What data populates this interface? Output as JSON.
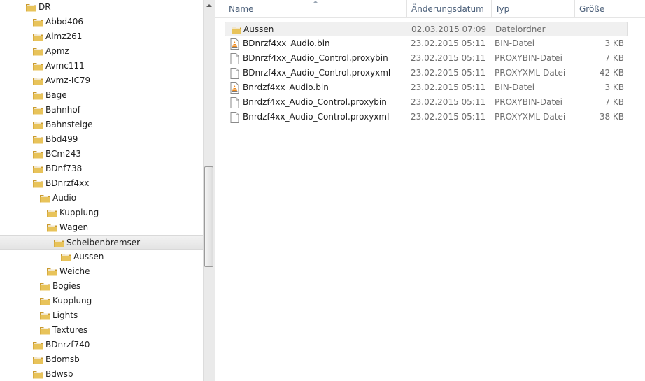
{
  "tree": {
    "items": [
      {
        "label": "DR",
        "depth": 0,
        "selected": false
      },
      {
        "label": "Abbd406",
        "depth": 1,
        "selected": false
      },
      {
        "label": "Aimz261",
        "depth": 1,
        "selected": false
      },
      {
        "label": "Apmz",
        "depth": 1,
        "selected": false
      },
      {
        "label": "Avmc111",
        "depth": 1,
        "selected": false
      },
      {
        "label": "Avmz-IC79",
        "depth": 1,
        "selected": false
      },
      {
        "label": "Bage",
        "depth": 1,
        "selected": false
      },
      {
        "label": "Bahnhof",
        "depth": 1,
        "selected": false
      },
      {
        "label": "Bahnsteige",
        "depth": 1,
        "selected": false
      },
      {
        "label": "Bbd499",
        "depth": 1,
        "selected": false
      },
      {
        "label": "BCm243",
        "depth": 1,
        "selected": false
      },
      {
        "label": "BDnf738",
        "depth": 1,
        "selected": false
      },
      {
        "label": "BDnrzf4xx",
        "depth": 1,
        "selected": false
      },
      {
        "label": "Audio",
        "depth": 2,
        "selected": false
      },
      {
        "label": "Kupplung",
        "depth": 3,
        "selected": false
      },
      {
        "label": "Wagen",
        "depth": 3,
        "selected": false
      },
      {
        "label": "Scheibenbremser",
        "depth": 4,
        "selected": true
      },
      {
        "label": "Aussen",
        "depth": 5,
        "selected": false
      },
      {
        "label": "Weiche",
        "depth": 3,
        "selected": false
      },
      {
        "label": "Bogies",
        "depth": 2,
        "selected": false
      },
      {
        "label": "Kupplung",
        "depth": 2,
        "selected": false
      },
      {
        "label": "Lights",
        "depth": 2,
        "selected": false
      },
      {
        "label": "Textures",
        "depth": 2,
        "selected": false
      },
      {
        "label": "BDnrzf740",
        "depth": 1,
        "selected": false
      },
      {
        "label": "Bdomsb",
        "depth": 1,
        "selected": false
      },
      {
        "label": "Bdwsb",
        "depth": 1,
        "selected": false
      }
    ]
  },
  "list": {
    "columns": {
      "name": "Name",
      "date": "Änderungsdatum",
      "type": "Typ",
      "size": "Größe"
    },
    "rows": [
      {
        "name": "Aussen",
        "date": "02.03.2015 07:09",
        "type": "Dateiordner",
        "size": "",
        "icon": "folder-icon",
        "highlight": true
      },
      {
        "name": "BDnrzf4xx_Audio.bin",
        "date": "23.02.2015 05:11",
        "type": "BIN-Datei",
        "size": "3 KB",
        "icon": "vlc-file-icon",
        "highlight": false
      },
      {
        "name": "BDnrzf4xx_Audio_Control.proxybin",
        "date": "23.02.2015 05:11",
        "type": "PROXYBIN-Datei",
        "size": "7 KB",
        "icon": "blank-file-icon",
        "highlight": false
      },
      {
        "name": "BDnrzf4xx_Audio_Control.proxyxml",
        "date": "23.02.2015 05:11",
        "type": "PROXYXML-Datei",
        "size": "42 KB",
        "icon": "blank-file-icon",
        "highlight": false
      },
      {
        "name": "Bnrdzf4xx_Audio.bin",
        "date": "23.02.2015 05:11",
        "type": "BIN-Datei",
        "size": "3 KB",
        "icon": "vlc-file-icon",
        "highlight": false
      },
      {
        "name": "Bnrdzf4xx_Audio_Control.proxybin",
        "date": "23.02.2015 05:11",
        "type": "PROXYBIN-Datei",
        "size": "7 KB",
        "icon": "blank-file-icon",
        "highlight": false
      },
      {
        "name": "Bnrdzf4xx_Audio_Control.proxyxml",
        "date": "23.02.2015 05:11",
        "type": "PROXYXML-Datei",
        "size": "38 KB",
        "icon": "blank-file-icon",
        "highlight": false
      }
    ]
  },
  "colors": {
    "folder": "#e8c35a",
    "folder_dark": "#c99a2e",
    "header_text": "#4c607a",
    "meta_text": "#6d6d6d",
    "vlc_orange": "#f08a1c"
  }
}
